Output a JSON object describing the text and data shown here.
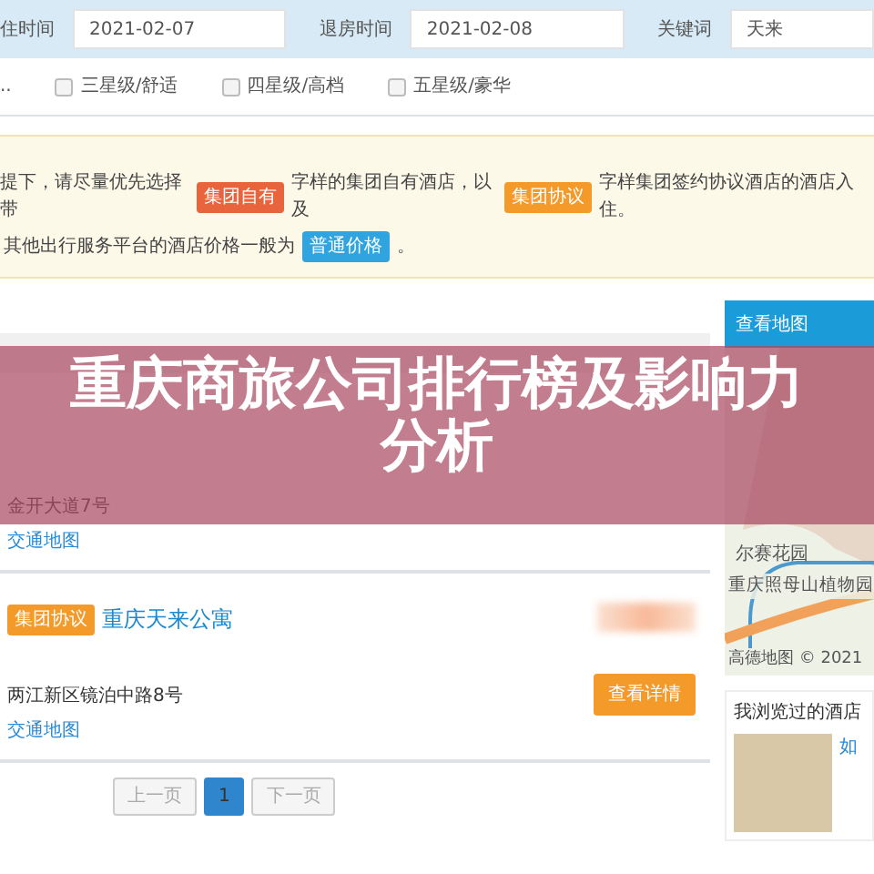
{
  "search_bar": {
    "fields": [
      {
        "label": "住时间",
        "value": "2021-02-07"
      },
      {
        "label": "退房时间",
        "value": "2021-02-08"
      },
      {
        "label": "关键词",
        "value": "天来"
      }
    ]
  },
  "star_filter": {
    "leading_text": "..",
    "options": [
      {
        "label": "三星级/舒适",
        "checked": false
      },
      {
        "label": "四星级/高档",
        "checked": false
      },
      {
        "label": "五星级/豪华",
        "checked": false
      }
    ]
  },
  "notice": {
    "lines": [
      [
        {
          "kind": "text",
          "text": "提下，请尽量优先选择带"
        },
        {
          "kind": "tag",
          "text": "集团自有",
          "color": "#e8643c"
        },
        {
          "kind": "text",
          "text": "字样的集团自有酒店，以及"
        },
        {
          "kind": "tag",
          "text": "集团协议",
          "color": "#f39a2b"
        },
        {
          "kind": "text",
          "text": "字样集团签约协议酒店的酒店入住。"
        }
      ],
      [
        {
          "kind": "text",
          "text": "其他出行服务平台的酒店价格一般为"
        },
        {
          "kind": "tag",
          "text": "普通价格",
          "color": "#2fa4de"
        },
        {
          "kind": "text",
          "text": "。"
        }
      ]
    ]
  },
  "hotels": [
    {
      "address": "金开大道7号",
      "map_link": "交通地图"
    },
    {
      "tag": {
        "text": "集团协议",
        "color": "#f39a2b"
      },
      "name": "重庆天来公寓",
      "address": "两江新区镜泊中路8号",
      "map_link": "交通地图",
      "button": "查看详情"
    }
  ],
  "pagination": [
    {
      "label": "上一页",
      "selected": false,
      "disabled": true
    },
    {
      "label": "1",
      "selected": true,
      "disabled": false
    },
    {
      "label": "下一页",
      "selected": false,
      "disabled": true
    }
  ],
  "sidebar": {
    "map_button": "查看地图",
    "map_labels": [
      "尔赛花园",
      "重庆照母山植物园"
    ],
    "map_credit": "高德地图 © 2021",
    "recent": {
      "title": "我浏览过的酒店",
      "items": [
        {
          "name": "如"
        }
      ]
    }
  },
  "overlay_title": "重庆商旅公司排行榜及影响力分析"
}
